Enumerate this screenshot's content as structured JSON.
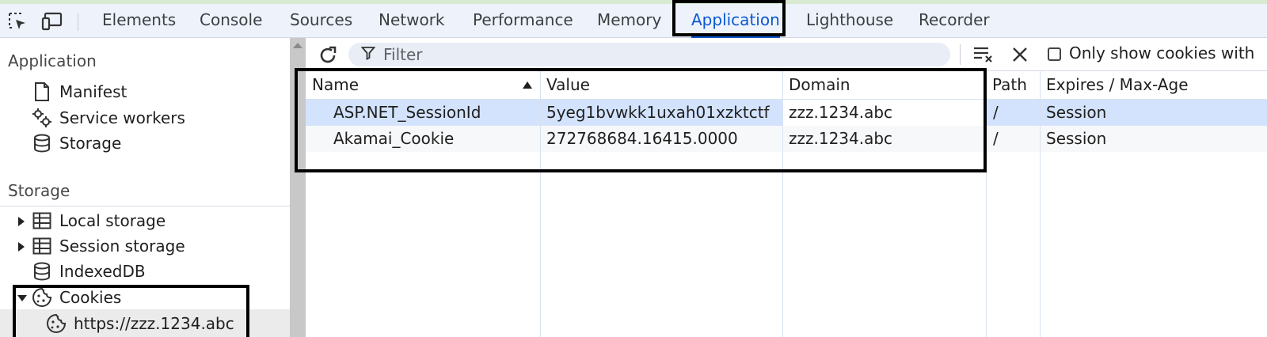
{
  "tabs": [
    {
      "label": "Elements"
    },
    {
      "label": "Console"
    },
    {
      "label": "Sources"
    },
    {
      "label": "Network"
    },
    {
      "label": "Performance"
    },
    {
      "label": "Memory"
    },
    {
      "label": "Application",
      "active": true
    },
    {
      "label": "Lighthouse"
    },
    {
      "label": "Recorder"
    }
  ],
  "toolbar_icons": [
    "inspect-element-icon",
    "device-toolbar-icon"
  ],
  "sidebar": {
    "application_heading": "Application",
    "application_items": [
      {
        "label": "Manifest",
        "icon": "document-icon"
      },
      {
        "label": "Service workers",
        "icon": "gears-icon"
      },
      {
        "label": "Storage",
        "icon": "database-icon"
      }
    ],
    "storage_heading": "Storage",
    "storage_items": [
      {
        "label": "Local storage",
        "icon": "table-icon",
        "expander": "collapsed"
      },
      {
        "label": "Session storage",
        "icon": "table-icon",
        "expander": "collapsed"
      },
      {
        "label": "IndexedDB",
        "icon": "database-icon"
      },
      {
        "label": "Cookies",
        "icon": "cookie-icon",
        "expander": "expanded"
      }
    ],
    "cookie_origin": "https://zzz.1234.abc"
  },
  "filter": {
    "placeholder": "Filter"
  },
  "only_show_label": "Only show cookies with",
  "table": {
    "columns": [
      "Name",
      "Value",
      "Domain",
      "Path",
      "Expires / Max-Age"
    ],
    "sorted_column": "Name",
    "sort_direction": "ascending",
    "rows": [
      {
        "name": "ASP.NET_SessionId",
        "value": "5yeg1bvwkk1uxah01xzktctf",
        "domain": "zzz.1234.abc",
        "path": "/",
        "expires": "Session"
      },
      {
        "name": "Akamai_Cookie",
        "value": "272768684.16415.0000",
        "domain": "zzz.1234.abc",
        "path": "/",
        "expires": "Session"
      }
    ]
  },
  "colors": {
    "accent": "#0b57d0",
    "selected_row": "#d3e3fd",
    "highlight_box": "#000000"
  }
}
